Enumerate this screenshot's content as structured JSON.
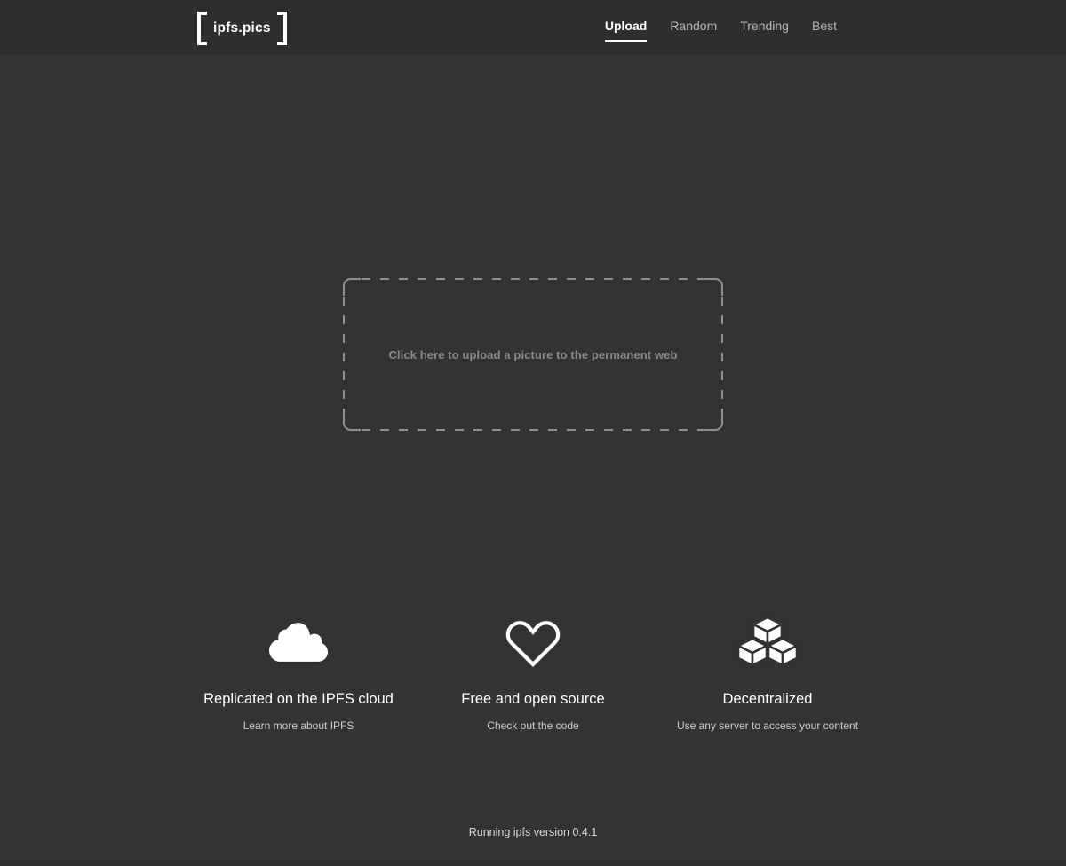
{
  "header": {
    "logo_text": "ipfs.pics",
    "nav": [
      {
        "label": "Upload",
        "active": true
      },
      {
        "label": "Random",
        "active": false
      },
      {
        "label": "Trending",
        "active": false
      },
      {
        "label": "Best",
        "active": false
      }
    ]
  },
  "upload": {
    "dropzone_label": "Click here to upload a picture to the permanent web"
  },
  "features": [
    {
      "icon": "cloud-icon",
      "title": "Replicated on the IPFS cloud",
      "link_label": "Learn more about IPFS"
    },
    {
      "icon": "heart-icon",
      "title": "Free and open source",
      "link_label": "Check out the code"
    },
    {
      "icon": "cubes-icon",
      "title": "Decentralized",
      "link_label": "Use any server to access your content"
    }
  ],
  "footer": {
    "version_text": "Running ipfs version 0.4.1"
  },
  "colors": {
    "page_background": "#333333",
    "header_background": "#2e2e2e",
    "accent_text": "#ffffff",
    "muted_text": "#b5b5b5",
    "dropzone_border": "#909090",
    "dropzone_text": "#8a8a8a"
  }
}
